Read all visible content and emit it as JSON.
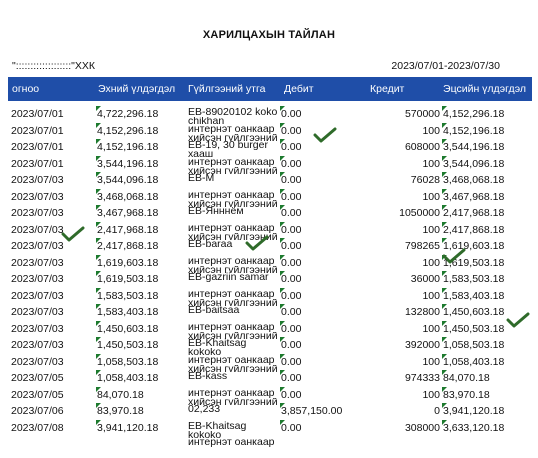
{
  "report": {
    "title": "ХАРИЛЦАХЫН ТАЙЛАН",
    "account": "\":::::::::::::::::::\"ХХК",
    "period": "2023/07/01-2023/07/30"
  },
  "table": {
    "headers": {
      "date": "огноо",
      "opening": "Эхний үлдэгдэл",
      "description": "Гүйлгээний утга",
      "debit": "Дебит",
      "credit": "Кредит",
      "closing": "Эцсийн үлдэгдэл"
    },
    "rows": [
      {
        "date": "2023/07/01",
        "opening": "4,722,296.18",
        "desc1": "EB-89020102 koko",
        "desc2": "chikhan",
        "debit": "0.00",
        "credit": "570000",
        "closing": "4,152,296.18"
      },
      {
        "date": "2023/07/01",
        "opening": "4,152,296.18",
        "desc1": "интернэт оанкаар",
        "desc2": "хийсэн гүйлгээний",
        "debit": "0.00",
        "credit": "100",
        "closing": "4,152,196.18"
      },
      {
        "date": "2023/07/01",
        "opening": "4,152,196.18",
        "desc1": "EB-19, 30 burger",
        "desc2": "хааш",
        "debit": "0.00",
        "credit": "608000",
        "closing": "3,544,196.18"
      },
      {
        "date": "2023/07/01",
        "opening": "3,544,196.18",
        "desc1": "интернэт оанкаар",
        "desc2": "хийсэн гүйлгээний",
        "debit": "0.00",
        "credit": "100",
        "closing": "3,544,096.18"
      },
      {
        "date": "2023/07/03",
        "opening": "3,544,096.18",
        "desc1": "EB-M",
        "desc2": "",
        "debit": "0.00",
        "credit": "76028",
        "closing": "3,468,068.18"
      },
      {
        "date": "2023/07/03",
        "opening": "3,468,068.18",
        "desc1": "интернэт оанкаар",
        "desc2": "хийсэн гүйлгээний",
        "debit": "0.00",
        "credit": "100",
        "closing": "3,467,968.18"
      },
      {
        "date": "2023/07/03",
        "opening": "3,467,968.18",
        "desc1": "EB-Янннём",
        "desc2": "",
        "debit": "0.00",
        "credit": "1050000",
        "closing": "2,417,968.18"
      },
      {
        "date": "2023/07/03",
        "opening": "2,417,968.18",
        "desc1": "интернэт оанкаар",
        "desc2": "хийсэн гүйлгээний",
        "debit": "0.00",
        "credit": "100",
        "closing": "2,417,868.18"
      },
      {
        "date": "2023/07/03",
        "opening": "2,417,868.18",
        "desc1": "EB-baraa",
        "desc2": "",
        "debit": "0.00",
        "credit": "798265",
        "closing": "1,619,603.18"
      },
      {
        "date": "2023/07/03",
        "opening": "1,619,603.18",
        "desc1": "интернэт оанкаар",
        "desc2": "хийсэн гүйлгээний",
        "debit": "0.00",
        "credit": "100",
        "closing": "1,619,503.18"
      },
      {
        "date": "2023/07/03",
        "opening": "1,619,503.18",
        "desc1": "EB-gazriin samar",
        "desc2": "",
        "debit": "0.00",
        "credit": "36000",
        "closing": "1,583,503.18"
      },
      {
        "date": "2023/07/03",
        "opening": "1,583,503.18",
        "desc1": "интернэт оанкаар",
        "desc2": "хийсэн гүйлгээний",
        "debit": "0.00",
        "credit": "100",
        "closing": "1,583,403.18"
      },
      {
        "date": "2023/07/03",
        "opening": "1,583,403.18",
        "desc1": "EB-baitsaa",
        "desc2": "",
        "debit": "0.00",
        "credit": "132800",
        "closing": "1,450,603.18"
      },
      {
        "date": "2023/07/03",
        "opening": "1,450,603.18",
        "desc1": "интернэт оанкаар",
        "desc2": "хийсэн гүйлгээний",
        "debit": "0.00",
        "credit": "100",
        "closing": "1,450,503.18"
      },
      {
        "date": "2023/07/03",
        "opening": "1,450,503.18",
        "desc1": "EB-Khaitsag",
        "desc2": "kokoko",
        "debit": "0.00",
        "credit": "392000",
        "closing": "1,058,503.18"
      },
      {
        "date": "2023/07/03",
        "opening": "1,058,503.18",
        "desc1": "интернэт оанкаар",
        "desc2": "хийсэн гүйлгээний",
        "debit": "0.00",
        "credit": "100",
        "closing": "1,058,403.18"
      },
      {
        "date": "2023/07/05",
        "opening": "1,058,403.18",
        "desc1": "EB-kass",
        "desc2": "",
        "debit": "0.00",
        "credit": "974333",
        "closing": "84,070.18"
      },
      {
        "date": "2023/07/05",
        "opening": "84,070.18",
        "desc1": "интернэт оанкаар",
        "desc2": "хийсэн гүйлгээний",
        "debit": "0.00",
        "credit": "100",
        "closing": "83,970.18"
      },
      {
        "date": "2023/07/06",
        "opening": "83,970.18",
        "desc1": "02,233",
        "desc2": "",
        "debit": "3,857,150.00",
        "credit": "0",
        "closing": "3,941,120.18"
      },
      {
        "date": "2023/07/08",
        "opening": "3,941,120.18",
        "desc1": "EB-Khaitsag",
        "desc2": "kokoko",
        "debit": "0.00",
        "credit": "308000",
        "closing": "3,633,120.18"
      },
      {
        "date": "",
        "opening": "",
        "desc1": "интернэт оанкаар",
        "desc2": "",
        "debit": "",
        "credit": "",
        "closing": ""
      }
    ]
  },
  "marks": {
    "check_color": "#2f6b2a",
    "checks": [
      {
        "name": "check-mark-1"
      },
      {
        "name": "check-mark-2"
      },
      {
        "name": "check-mark-3"
      },
      {
        "name": "check-mark-4"
      },
      {
        "name": "check-mark-5"
      }
    ]
  }
}
